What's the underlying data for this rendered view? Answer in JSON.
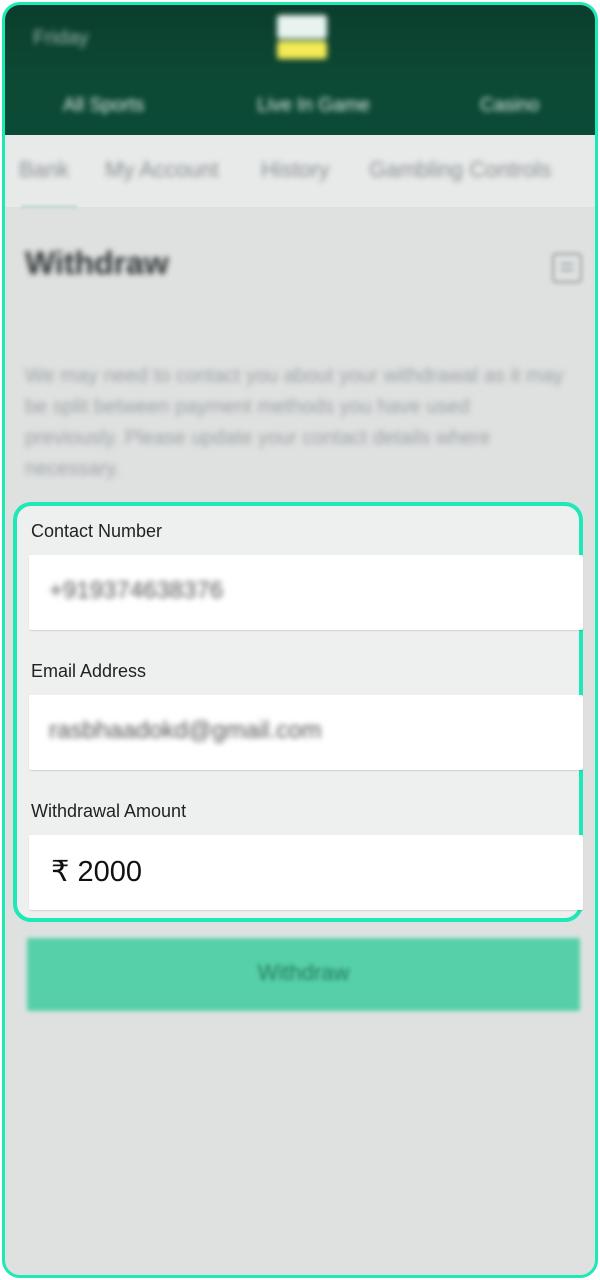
{
  "header": {
    "left_label": "Friday",
    "logo_icon": "brand-logo-icon",
    "nav": [
      "All Sports",
      "Live In Game",
      "Casino"
    ]
  },
  "subtabs": [
    "Bank",
    "My Account",
    "History",
    "Gambling Controls"
  ],
  "page": {
    "title": "Withdraw",
    "info": "We may need to contact you about your withdrawal as it may be split between payment methods you have used previously. Please update your contact details where necessary."
  },
  "form": {
    "contact_label": "Contact Number",
    "contact_value": "+919374638376",
    "email_label": "Email Address",
    "email_value": "rasbhaadokd@gmail.com",
    "amount_label": "Withdrawal Amount",
    "currency_symbol": "₹",
    "amount_value": "2000"
  },
  "withdraw_button": "Withdraw",
  "colors": {
    "highlight": "#1de9b6",
    "header": "#0c4a36",
    "button": "#55d0a8"
  }
}
